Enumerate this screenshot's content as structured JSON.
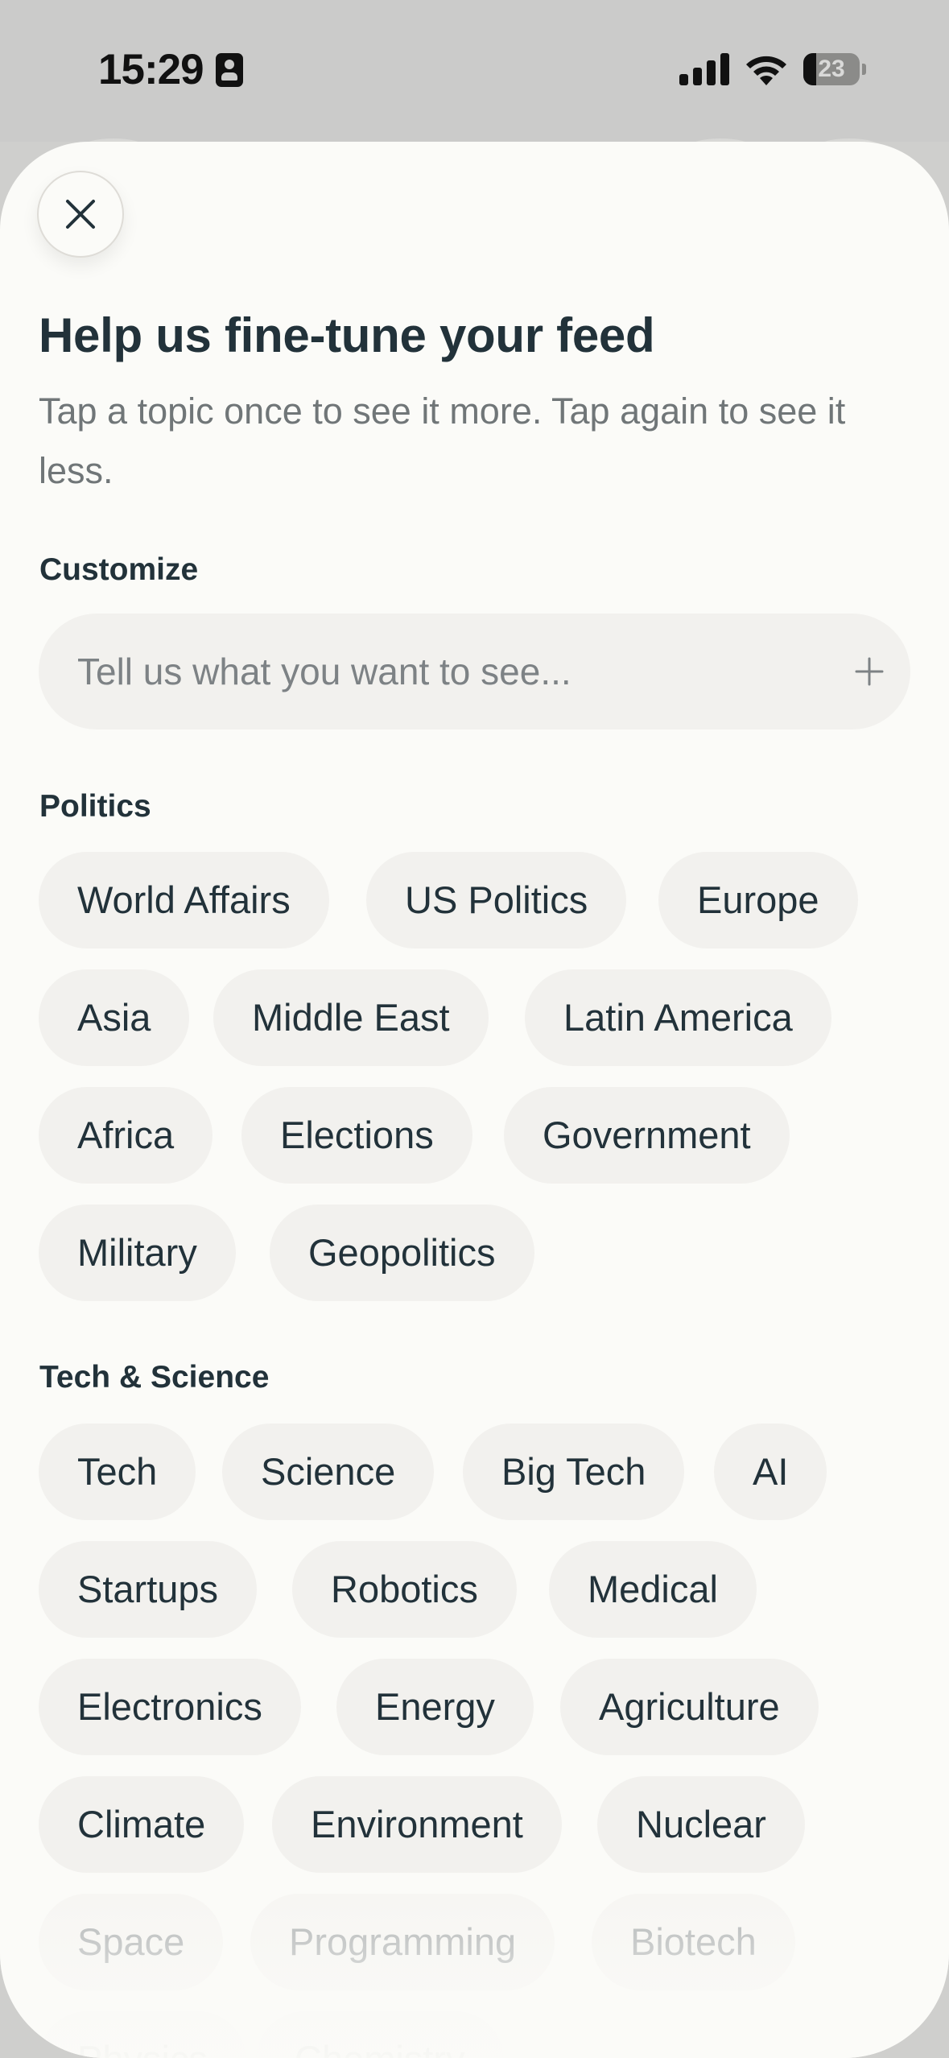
{
  "status_bar": {
    "time": "15:29",
    "battery_percent": "23",
    "battery_level": 0.23
  },
  "sheet": {
    "title": "Help us fine-tune your feed",
    "subtitle": "Tap a topic once to see it more. Tap again to see it less.",
    "close_icon": "close-icon"
  },
  "customize": {
    "label": "Customize",
    "placeholder": "Tell us what you want to see...",
    "add_icon": "plus-icon"
  },
  "sections": [
    {
      "label": "Politics",
      "topics": [
        "World Affairs",
        "US Politics",
        "Europe",
        "Asia",
        "Middle East",
        "Latin America",
        "Africa",
        "Elections",
        "Government",
        "Military",
        "Geopolitics"
      ]
    },
    {
      "label": "Tech & Science",
      "topics": [
        "Tech",
        "Science",
        "Big Tech",
        "AI",
        "Startups",
        "Robotics",
        "Medical",
        "Electronics",
        "Energy",
        "Agriculture",
        "Climate",
        "Environment",
        "Nuclear",
        "Space",
        "Programming",
        "Biotech",
        "Physics",
        "Chemistry"
      ]
    }
  ],
  "colors": {
    "sheet_background": "#fbfbf8",
    "chip_background": "#f2f1ee",
    "text_primary": "#22323a",
    "text_secondary": "#707678"
  }
}
